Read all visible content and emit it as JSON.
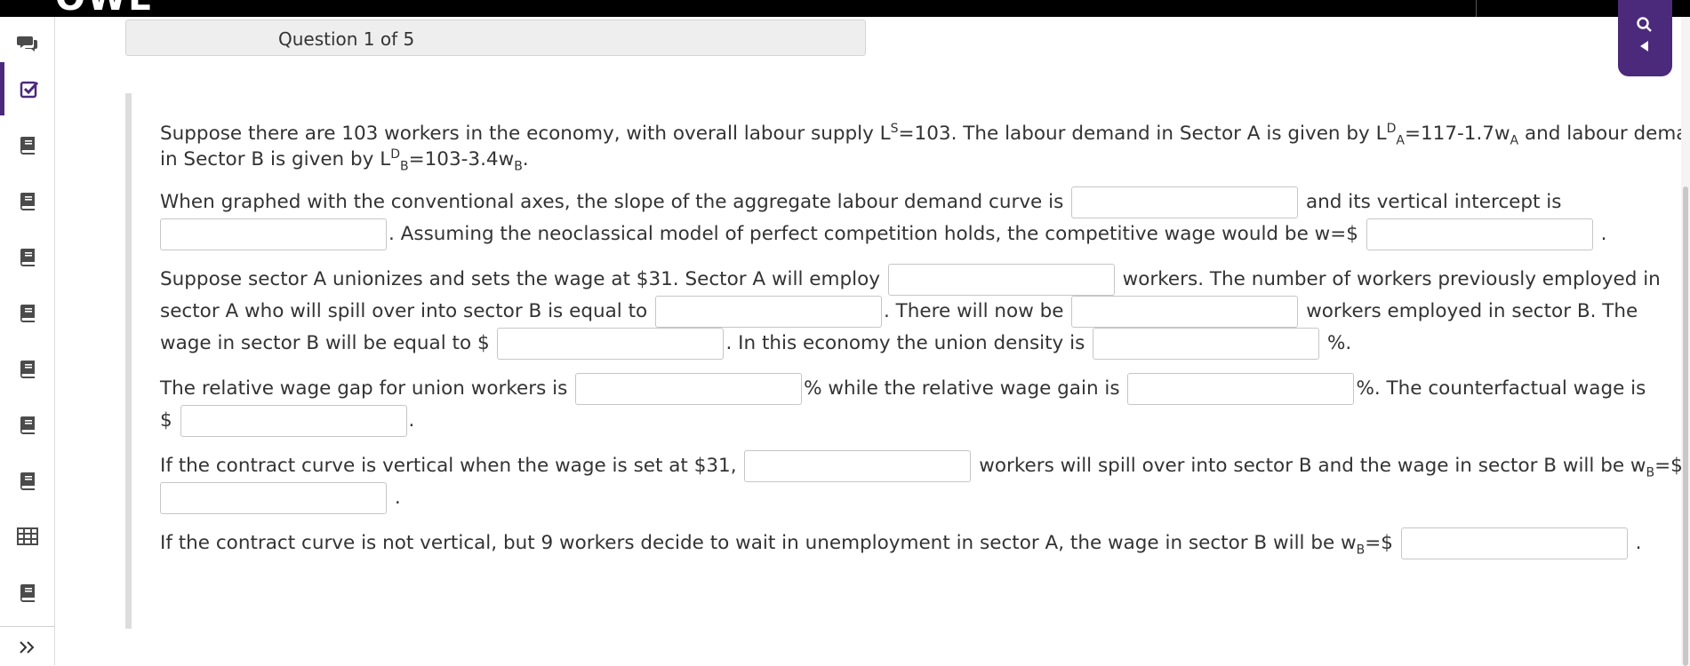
{
  "header": {
    "question_counter": "Question 1 of 5"
  },
  "sidebar": {
    "items": [
      {
        "icon": "chat-icon"
      },
      {
        "icon": "checkbox-icon",
        "active": true
      },
      {
        "icon": "book-icon"
      },
      {
        "icon": "book-icon"
      },
      {
        "icon": "book-icon"
      },
      {
        "icon": "book-icon"
      },
      {
        "icon": "book-icon"
      },
      {
        "icon": "book-icon"
      },
      {
        "icon": "book-icon"
      },
      {
        "icon": "table-icon"
      },
      {
        "icon": "book-icon"
      }
    ],
    "expand_icon": "double-chevron-right-icon"
  },
  "question": {
    "intro": {
      "t1": "Suppose there are 103 workers in the economy, with overall labour supply L",
      "t2": "S",
      "t3": "=103. The labour demand in Sector A is given by L",
      "t4": "D",
      "t5": "A",
      "t6": "=117-1.7w",
      "t7": "A",
      "t8": " and labour demand",
      "t9": "in Sector B is given by L",
      "t10": "D",
      "t11": "B",
      "t12": "=103-3.4w",
      "t13": "B",
      "t14": "."
    },
    "p2": {
      "t1": "When graphed with the conventional axes, the slope of the aggregate labour demand curve is",
      "t2": "and its vertical intercept is",
      "t3": ". Assuming the neoclassical model of perfect competition holds, the competitive wage would be w=$",
      "t4": "."
    },
    "p3": {
      "t1": "Suppose sector A unionizes and sets the wage at $31. Sector A will employ",
      "t2": "workers. The number of workers previously employed in",
      "t3": "sector A who will spill over into sector B is equal to",
      "t4": ". There will now be",
      "t5": "workers employed in sector B. The",
      "t6": "wage in sector B will be equal to $",
      "t7": ". In this economy the union density is",
      "t8": "%."
    },
    "p4": {
      "t1": "The relative wage gap for union workers is",
      "t2": "% while the relative wage gain is",
      "t3": "%. The counterfactual wage is",
      "t4": "$",
      "t5": "."
    },
    "p5": {
      "t1": "If the contract curve is vertical when the wage is set at $31,",
      "t2": "workers will spill over into sector B and the wage in sector B will be w",
      "t3": "B",
      "t4": "=$",
      "t5": "."
    },
    "p6": {
      "t1": "If the contract curve is not vertical, but 9 workers decide to wait in unemployment in sector A, the wage in sector B will be w",
      "t2": "B",
      "t3": "=$",
      "t4": "."
    },
    "answers": {
      "slope": "",
      "intercept": "",
      "competitive_wage": "",
      "sector_a_employ": "",
      "spillover": "",
      "sector_b_employed": "",
      "sector_b_wage": "",
      "union_density": "",
      "wage_gap": "",
      "wage_gain": "",
      "counterfactual_wage": "",
      "vertical_spillover": "",
      "vertical_wage_b": "",
      "wait_wage_b": ""
    }
  },
  "colors": {
    "accent": "#4b2a7b",
    "topbar": "#000000",
    "text": "#333333"
  }
}
